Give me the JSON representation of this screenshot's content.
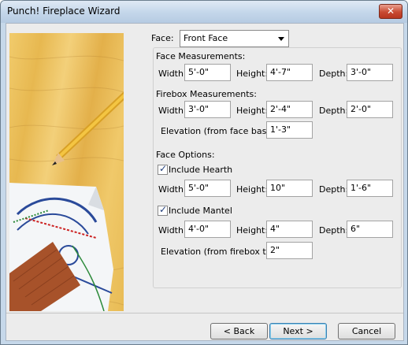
{
  "window": {
    "title": "Punch! Fireplace Wizard"
  },
  "face": {
    "label": "Face:",
    "selected": "Front Face"
  },
  "face_measurements": {
    "heading": "Face Measurements:",
    "width_label": "Width:",
    "width": "5'-0\"",
    "height_label": "Height:",
    "height": "4'-7\"",
    "depth_label": "Depth:",
    "depth": "3'-0\""
  },
  "firebox_measurements": {
    "heading": "Firebox Measurements:",
    "width_label": "Width:",
    "width": "3'-0\"",
    "height_label": "Height:",
    "height": "2'-4\"",
    "depth_label": "Depth:",
    "depth": "2'-0\"",
    "elevation_label": "Elevation (from face base):",
    "elevation": "1'-3\""
  },
  "face_options": {
    "heading": "Face Options:"
  },
  "hearth": {
    "include_label": "Include Hearth",
    "checked": true,
    "width_label": "Width:",
    "width": "5'-0\"",
    "height_label": "Height:",
    "height": "10\"",
    "depth_label": "Depth:",
    "depth": "1'-6\""
  },
  "mantel": {
    "include_label": "Include Mantel",
    "checked": true,
    "width_label": "Width:",
    "width": "4'-0\"",
    "height_label": "Height:",
    "height": "4\"",
    "depth_label": "Depth:",
    "depth": "6\"",
    "elevation_label": "Elevation (from firebox top):",
    "elevation": "2\""
  },
  "buttons": {
    "back": "< Back",
    "next": "Next >",
    "cancel": "Cancel"
  }
}
